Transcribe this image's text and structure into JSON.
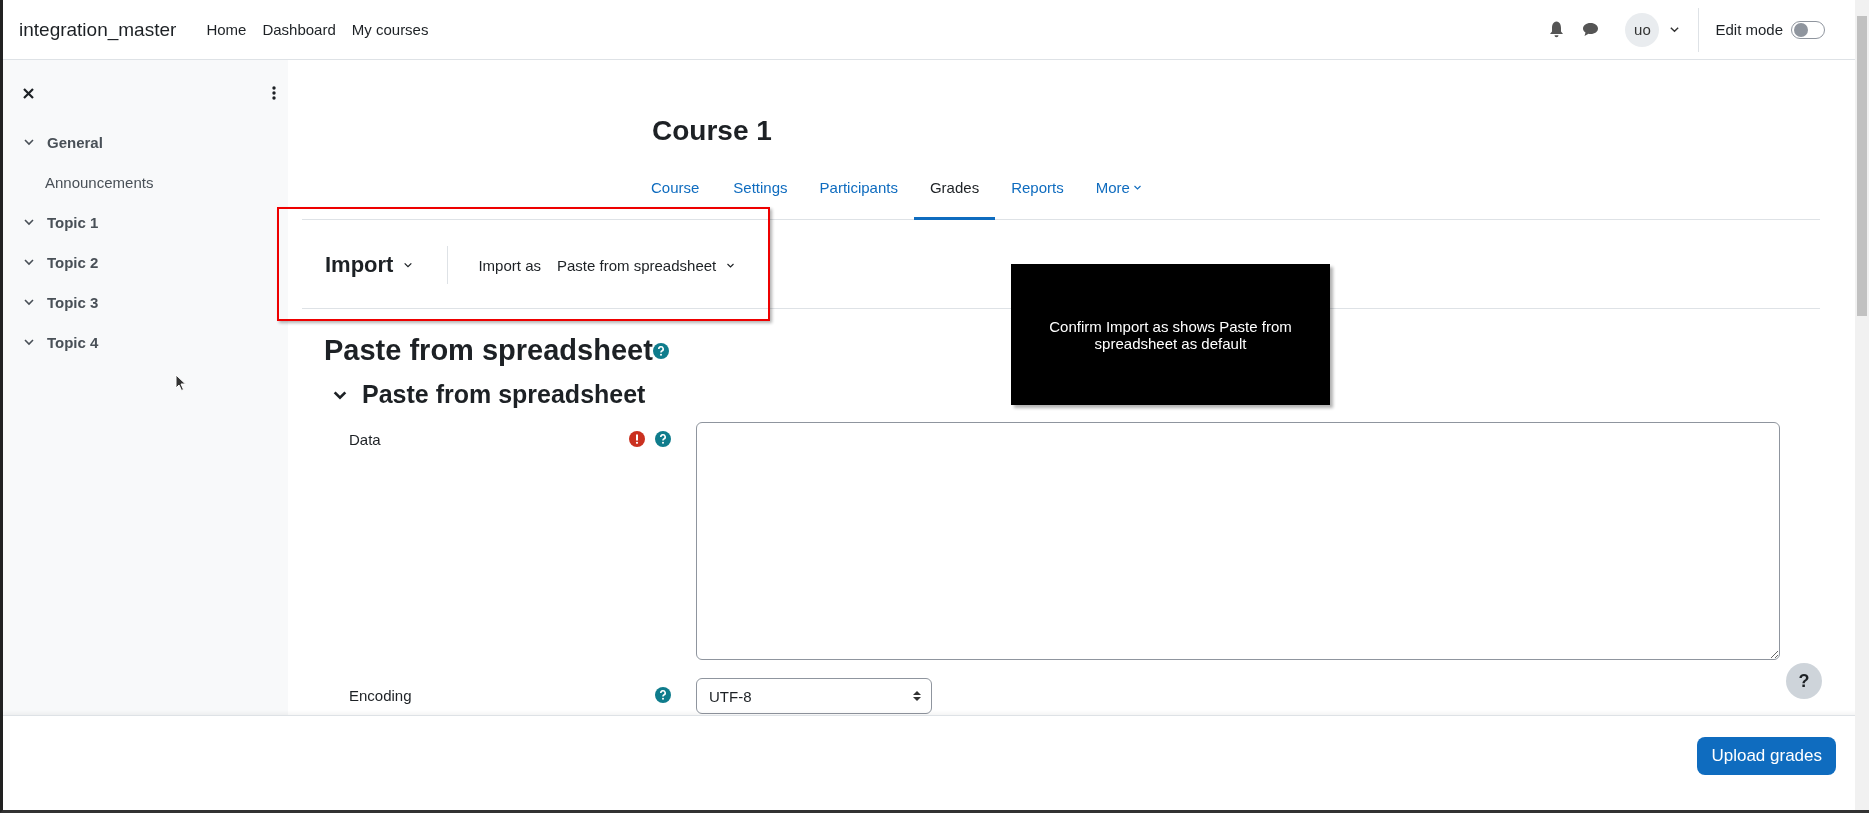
{
  "header": {
    "brand": "integration_master",
    "nav": [
      {
        "label": "Home"
      },
      {
        "label": "Dashboard"
      },
      {
        "label": "My courses"
      }
    ],
    "avatar": "uo",
    "edit_mode": {
      "label": "Edit mode",
      "on": false
    }
  },
  "sidebar": {
    "items": [
      {
        "label": "General",
        "expanded": true,
        "children": [
          {
            "label": "Announcements"
          }
        ]
      },
      {
        "label": "Topic 1",
        "expanded": true
      },
      {
        "label": "Topic 2",
        "expanded": true
      },
      {
        "label": "Topic 3",
        "expanded": true
      },
      {
        "label": "Topic 4",
        "expanded": true
      }
    ]
  },
  "course": {
    "title": "Course 1",
    "tabs": [
      {
        "label": "Course",
        "selected": false,
        "kind": "link"
      },
      {
        "label": "Settings",
        "selected": false,
        "kind": "link"
      },
      {
        "label": "Participants",
        "selected": false,
        "kind": "link"
      },
      {
        "label": "Grades",
        "selected": true,
        "kind": "link"
      },
      {
        "label": "Reports",
        "selected": false,
        "kind": "link"
      },
      {
        "label": "More",
        "selected": false,
        "kind": "menu"
      }
    ]
  },
  "import_bar": {
    "heading": "Import",
    "label": "Import as",
    "value": "Paste from spreadsheet"
  },
  "form": {
    "title": "Paste from spreadsheet",
    "section": {
      "title": "Paste from spreadsheet",
      "expanded": true
    },
    "fields": [
      {
        "kind": "textarea",
        "label": "Data",
        "required": true
      },
      {
        "kind": "select",
        "label": "Encoding",
        "required": false,
        "value": "UTF-8"
      }
    ]
  },
  "help_button": "?",
  "footer": {
    "button": "Upload grades"
  },
  "annotation": {
    "text": "Confirm Import as shows Paste from spreadsheet as default"
  }
}
